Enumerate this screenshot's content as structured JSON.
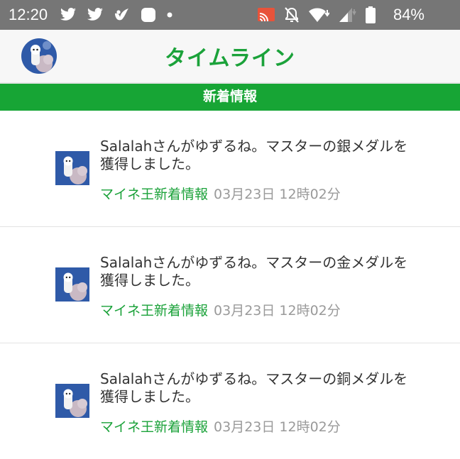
{
  "status_bar": {
    "time": "12:20",
    "battery_percent": "84%",
    "left_icons": [
      "twitter-icon",
      "twitter-icon",
      "app-bird-icon",
      "app-square-icon",
      "dot-icon"
    ],
    "right_icons": [
      "cast-icon",
      "mute-icon",
      "wifi-icon",
      "signal-icon",
      "battery-icon"
    ]
  },
  "header": {
    "title": "タイムライン",
    "title_color": "#1ba23a"
  },
  "banner": {
    "label": "新着情報",
    "color": "#17a535"
  },
  "feed": {
    "items": [
      {
        "text": "Salalahさんがゆずるね。マスターの銀メダルを獲得しました。",
        "source": "マイネ王新着情報",
        "date": "03月23日 12時02分"
      },
      {
        "text": "Salalahさんがゆずるね。マスターの金メダルを獲得しました。",
        "source": "マイネ王新着情報",
        "date": "03月23日 12時02分"
      },
      {
        "text": "Salalahさんがゆずるね。マスターの銅メダルを獲得しました。",
        "source": "マイネ王新着情報",
        "date": "03月23日 12時02分"
      }
    ]
  }
}
